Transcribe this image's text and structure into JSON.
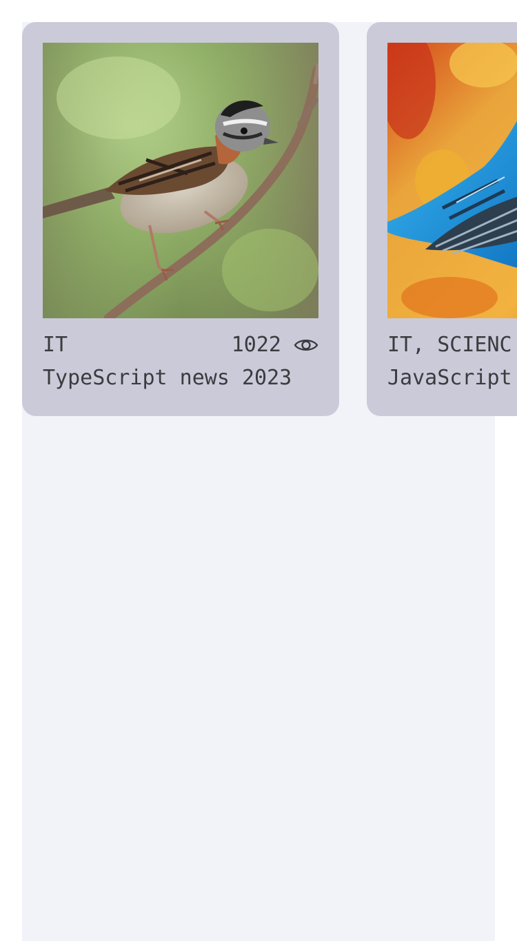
{
  "cards": [
    {
      "image": "sparrow-photo",
      "category": "IT",
      "views": "1022",
      "views_icon": "eye-icon",
      "title": "TypeScript news 2023"
    },
    {
      "image": "blue-bird-photo",
      "category": "IT, SCIENC",
      "title": "JavaScript"
    }
  ],
  "colors": {
    "page_bg": "#ffffff",
    "panel_bg": "#f2f3f9",
    "card_bg": "#cbcad9",
    "text": "#3b3b3f"
  }
}
